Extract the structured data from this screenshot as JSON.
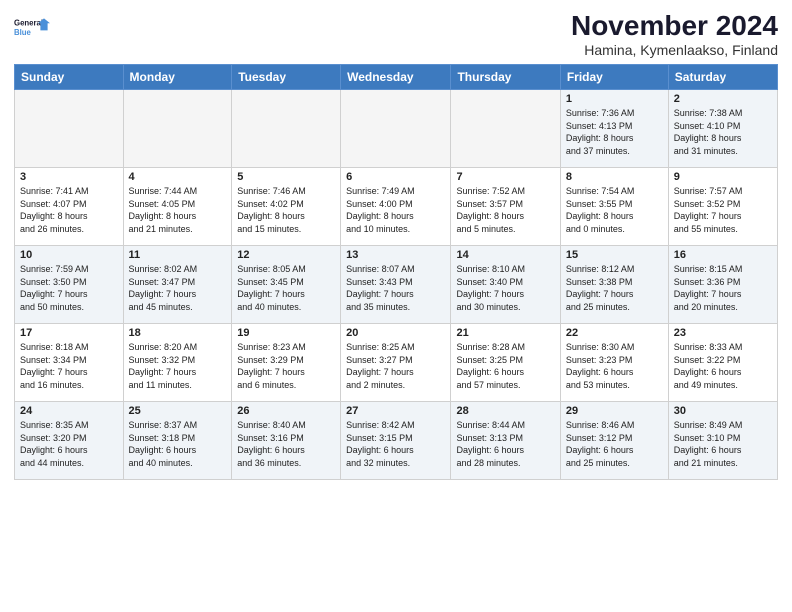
{
  "logo": {
    "line1": "General",
    "line2": "Blue"
  },
  "title": "November 2024",
  "location": "Hamina, Kymenlaakso, Finland",
  "weekdays": [
    "Sunday",
    "Monday",
    "Tuesday",
    "Wednesday",
    "Thursday",
    "Friday",
    "Saturday"
  ],
  "weeks": [
    [
      {
        "day": "",
        "info": ""
      },
      {
        "day": "",
        "info": ""
      },
      {
        "day": "",
        "info": ""
      },
      {
        "day": "",
        "info": ""
      },
      {
        "day": "",
        "info": ""
      },
      {
        "day": "1",
        "info": "Sunrise: 7:36 AM\nSunset: 4:13 PM\nDaylight: 8 hours\nand 37 minutes."
      },
      {
        "day": "2",
        "info": "Sunrise: 7:38 AM\nSunset: 4:10 PM\nDaylight: 8 hours\nand 31 minutes."
      }
    ],
    [
      {
        "day": "3",
        "info": "Sunrise: 7:41 AM\nSunset: 4:07 PM\nDaylight: 8 hours\nand 26 minutes."
      },
      {
        "day": "4",
        "info": "Sunrise: 7:44 AM\nSunset: 4:05 PM\nDaylight: 8 hours\nand 21 minutes."
      },
      {
        "day": "5",
        "info": "Sunrise: 7:46 AM\nSunset: 4:02 PM\nDaylight: 8 hours\nand 15 minutes."
      },
      {
        "day": "6",
        "info": "Sunrise: 7:49 AM\nSunset: 4:00 PM\nDaylight: 8 hours\nand 10 minutes."
      },
      {
        "day": "7",
        "info": "Sunrise: 7:52 AM\nSunset: 3:57 PM\nDaylight: 8 hours\nand 5 minutes."
      },
      {
        "day": "8",
        "info": "Sunrise: 7:54 AM\nSunset: 3:55 PM\nDaylight: 8 hours\nand 0 minutes."
      },
      {
        "day": "9",
        "info": "Sunrise: 7:57 AM\nSunset: 3:52 PM\nDaylight: 7 hours\nand 55 minutes."
      }
    ],
    [
      {
        "day": "10",
        "info": "Sunrise: 7:59 AM\nSunset: 3:50 PM\nDaylight: 7 hours\nand 50 minutes."
      },
      {
        "day": "11",
        "info": "Sunrise: 8:02 AM\nSunset: 3:47 PM\nDaylight: 7 hours\nand 45 minutes."
      },
      {
        "day": "12",
        "info": "Sunrise: 8:05 AM\nSunset: 3:45 PM\nDaylight: 7 hours\nand 40 minutes."
      },
      {
        "day": "13",
        "info": "Sunrise: 8:07 AM\nSunset: 3:43 PM\nDaylight: 7 hours\nand 35 minutes."
      },
      {
        "day": "14",
        "info": "Sunrise: 8:10 AM\nSunset: 3:40 PM\nDaylight: 7 hours\nand 30 minutes."
      },
      {
        "day": "15",
        "info": "Sunrise: 8:12 AM\nSunset: 3:38 PM\nDaylight: 7 hours\nand 25 minutes."
      },
      {
        "day": "16",
        "info": "Sunrise: 8:15 AM\nSunset: 3:36 PM\nDaylight: 7 hours\nand 20 minutes."
      }
    ],
    [
      {
        "day": "17",
        "info": "Sunrise: 8:18 AM\nSunset: 3:34 PM\nDaylight: 7 hours\nand 16 minutes."
      },
      {
        "day": "18",
        "info": "Sunrise: 8:20 AM\nSunset: 3:32 PM\nDaylight: 7 hours\nand 11 minutes."
      },
      {
        "day": "19",
        "info": "Sunrise: 8:23 AM\nSunset: 3:29 PM\nDaylight: 7 hours\nand 6 minutes."
      },
      {
        "day": "20",
        "info": "Sunrise: 8:25 AM\nSunset: 3:27 PM\nDaylight: 7 hours\nand 2 minutes."
      },
      {
        "day": "21",
        "info": "Sunrise: 8:28 AM\nSunset: 3:25 PM\nDaylight: 6 hours\nand 57 minutes."
      },
      {
        "day": "22",
        "info": "Sunrise: 8:30 AM\nSunset: 3:23 PM\nDaylight: 6 hours\nand 53 minutes."
      },
      {
        "day": "23",
        "info": "Sunrise: 8:33 AM\nSunset: 3:22 PM\nDaylight: 6 hours\nand 49 minutes."
      }
    ],
    [
      {
        "day": "24",
        "info": "Sunrise: 8:35 AM\nSunset: 3:20 PM\nDaylight: 6 hours\nand 44 minutes."
      },
      {
        "day": "25",
        "info": "Sunrise: 8:37 AM\nSunset: 3:18 PM\nDaylight: 6 hours\nand 40 minutes."
      },
      {
        "day": "26",
        "info": "Sunrise: 8:40 AM\nSunset: 3:16 PM\nDaylight: 6 hours\nand 36 minutes."
      },
      {
        "day": "27",
        "info": "Sunrise: 8:42 AM\nSunset: 3:15 PM\nDaylight: 6 hours\nand 32 minutes."
      },
      {
        "day": "28",
        "info": "Sunrise: 8:44 AM\nSunset: 3:13 PM\nDaylight: 6 hours\nand 28 minutes."
      },
      {
        "day": "29",
        "info": "Sunrise: 8:46 AM\nSunset: 3:12 PM\nDaylight: 6 hours\nand 25 minutes."
      },
      {
        "day": "30",
        "info": "Sunrise: 8:49 AM\nSunset: 3:10 PM\nDaylight: 6 hours\nand 21 minutes."
      }
    ]
  ]
}
